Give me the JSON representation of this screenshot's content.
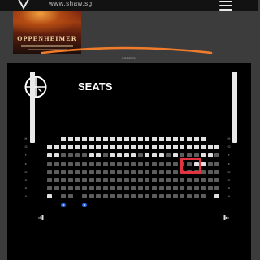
{
  "header": {
    "site_url": "www.shaw.sg",
    "logo_icon": "shaw-logo-icon",
    "menu_icon": "hamburger-menu-icon"
  },
  "poster": {
    "title": "OPPENHEIMER"
  },
  "seats_panel": {
    "icon": "seat-selection-icon",
    "title": "SEATS",
    "screen_label": "SCREEN",
    "screen_color": "#f07b2a",
    "row_letters": [
      "H",
      "G",
      "F",
      "E",
      "D",
      "C",
      "B",
      "A"
    ],
    "seat_rows": [
      {
        "letter": "H",
        "seats": "  aaaaaaaaaaaaaaaaaaaaa   "
      },
      {
        "letter": "G",
        "seats": "aaaaaaaaaaaaaaaaaaaaaaaaa"
      },
      {
        "letter": "F",
        "seats": "aattttaataaaataaatatttaat"
      },
      {
        "letter": "E",
        "seats": "tttttttttttttttttttttaatt"
      },
      {
        "letter": "D",
        "seats": "ttttttttttttttttttttttttt"
      },
      {
        "letter": "C",
        "seats": "ttttttttttttttttttttttttt"
      },
      {
        "letter": "B",
        "seats": "ttttttttttttttttttttttttt"
      },
      {
        "letter": "A",
        "seats": "a tt tttttttttttttttttt a"
      },
      {
        "letter": "",
        "seats": "  w  w                   "
      }
    ],
    "colors": {
      "available": "#e1e1e1",
      "occupied": "#5d5d5d",
      "wheelchair": "#1f4fd6",
      "selected_outline": "#e2333f"
    },
    "exit_icon": "exit-icon"
  }
}
